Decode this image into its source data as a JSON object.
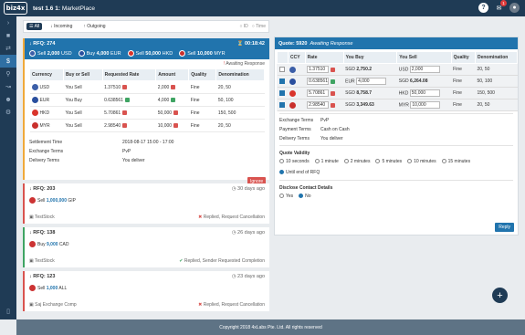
{
  "app": {
    "logo": "biz4x",
    "title": "test 1.6 1:",
    "subtitle": "MarketPlace",
    "notification_count": "1"
  },
  "filters": {
    "all": "All",
    "incoming": "Incoming",
    "outgoing": "Outgoing",
    "sort_id": "ID",
    "sort_time": "Time"
  },
  "active_rfq": {
    "title": "RFQ: 274",
    "timer": "00:18:42",
    "legs": [
      {
        "dir": "Sell",
        "amount": "2,000",
        "ccy": "USD",
        "color": "#3c5fa8"
      },
      {
        "dir": "Buy",
        "amount": "4,000",
        "ccy": "EUR",
        "color": "#2a4f9e"
      },
      {
        "dir": "Sell",
        "amount": "50,000",
        "ccy": "HKD",
        "color": "#d9342b"
      },
      {
        "dir": "Sell",
        "amount": "10,000",
        "ccy": "MYR",
        "color": "#c9302c"
      }
    ],
    "status": "Awaiting Response",
    "columns": [
      "Currency",
      "Buy or Sell",
      "Requested Rate",
      "Amount",
      "Quality",
      "Denomination"
    ],
    "rows": [
      {
        "ccy": "USD",
        "side": "You Sell",
        "rate": "1.37510",
        "amount": "2,000",
        "quality": "Fine",
        "denom": "20, 50",
        "lock": "red",
        "color": "#3c5fa8"
      },
      {
        "ccy": "EUR",
        "side": "You Buy",
        "rate": "0.638561",
        "amount": "4,000",
        "quality": "Fine",
        "denom": "50, 100",
        "lock": "green",
        "color": "#2a4f9e"
      },
      {
        "ccy": "HKD",
        "side": "You Sell",
        "rate": "5.70861",
        "amount": "50,000",
        "quality": "Fine",
        "denom": "150, 500",
        "lock": "red",
        "color": "#d9342b"
      },
      {
        "ccy": "MYR",
        "side": "You Sell",
        "rate": "2.98540",
        "amount": "10,000",
        "quality": "Fine",
        "denom": "20, 50",
        "lock": "red",
        "color": "#c9302c"
      }
    ],
    "settlement_time_label": "Settlement Time",
    "settlement_time": "2018-08-17 15:00 - 17:00",
    "exchange_terms_label": "Exchange Terms",
    "exchange_terms": "PvP",
    "delivery_terms_label": "Delivery Terms",
    "delivery_terms": "You deliver",
    "ignore_label": "Ignore"
  },
  "rfq_list": [
    {
      "title": "RFQ: 203",
      "ago": "30 days ago",
      "side": "Sell",
      "amount": "1,000,000",
      "ccy": "GIP",
      "company": "TestStock",
      "status": "Replied, Request Cancellation",
      "ok": false
    },
    {
      "title": "RFQ: 138",
      "ago": "26 days ago",
      "side": "Buy",
      "amount": "9,000",
      "ccy": "CAD",
      "company": "TestStock",
      "status": "Replied, Sender Requested Completion",
      "ok": true
    },
    {
      "title": "RFQ: 123",
      "ago": "23 days ago",
      "side": "Sell",
      "amount": "1,000",
      "ccy": "ALL",
      "company": "Saj Exchange Comp",
      "status": "Replied, Request Cancellation",
      "ok": false
    }
  ],
  "quote": {
    "title": "Quote: 5920",
    "subtitle": "Awaiting Response",
    "columns": [
      "CCY",
      "Rate",
      "You Buy",
      "You Sell",
      "Quality",
      "Denomination"
    ],
    "rows": [
      {
        "rate": "1.37510",
        "buy_ccy": "SGD",
        "buy": "2,750.2",
        "sell_ccy": "USD",
        "sell": "2,000",
        "quality": "Fine",
        "denom": "20, 50",
        "checked": false,
        "lock": "red",
        "color": "#3c5fa8"
      },
      {
        "rate": "0.638561",
        "buy_ccy": "EUR",
        "buy": "4,000",
        "sell_ccy": "SGD",
        "sell": "6,264.08",
        "quality": "Fine",
        "denom": "50, 100",
        "checked": true,
        "lock": "green",
        "color": "#2a4f9e"
      },
      {
        "rate": "5.70861",
        "buy_ccy": "SGD",
        "buy": "8,758.7",
        "sell_ccy": "HKD",
        "sell": "50,000",
        "quality": "Fine",
        "denom": "150, 500",
        "checked": true,
        "lock": "red",
        "color": "#d9342b"
      },
      {
        "rate": "2.98540",
        "buy_ccy": "SGD",
        "buy": "3,349.63",
        "sell_ccy": "MYR",
        "sell": "10,000",
        "quality": "Fine",
        "denom": "20, 50",
        "checked": true,
        "lock": "red",
        "color": "#c9302c"
      }
    ],
    "exchange_terms_label": "Exchange Terms",
    "exchange_terms": "PvP",
    "payment_terms_label": "Payment Terms",
    "payment_terms": "Cash on Cash",
    "delivery_terms_label": "Delivery Terms",
    "delivery_terms": "You deliver",
    "validity_label": "Quote Validity",
    "validity_options": [
      "10 seconds",
      "1 minute",
      "2 minutes",
      "5 minutes",
      "10 minutes",
      "15 minutes",
      "Until end of RFQ"
    ],
    "validity_selected": "Until end of RFQ",
    "disclose_label": "Disclose Contact Details",
    "disclose_options": [
      "Yes",
      "No"
    ],
    "disclose_selected": "No",
    "reply_label": "Reply"
  },
  "footer": "Copyright 2018 4xLabs Pte. Ltd. All rights reserved"
}
